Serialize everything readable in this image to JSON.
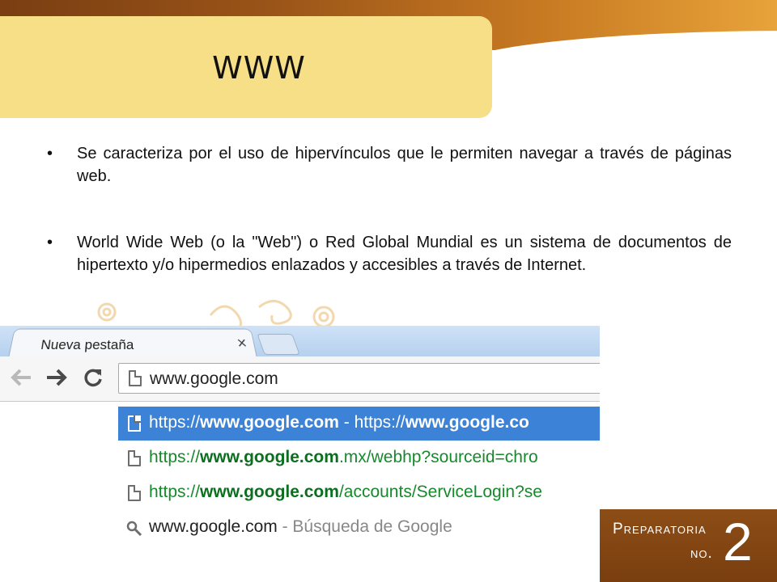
{
  "slide": {
    "title": "WWW",
    "bullets": [
      "Se caracteriza por el uso de hipervínculos que le permiten navegar a través de páginas web.",
      "World Wide Web (o la \"Web\") o Red Global Mundial es un sistema de documentos de hipertexto y/o hipermedios enlazados y accesibles a través de Internet."
    ],
    "bullet_symbol": "•"
  },
  "browser": {
    "tab_label": "Nueva pestaña",
    "tab_close": "×",
    "omnibox_value": "www.google.com",
    "suggestions": [
      {
        "prefix": "https://",
        "bold": "www.google.com",
        "rest": "",
        "separator": " - ",
        "extra_prefix": "https://",
        "extra_bold": "www.google.co",
        "icon": "page-icon"
      },
      {
        "prefix": "https://",
        "bold": "www.google.com",
        "rest": ".mx/webhp?sourceid=chro",
        "icon": "page-icon"
      },
      {
        "prefix": "https://",
        "bold": "www.google.com",
        "rest": "/accounts/ServiceLogin?se",
        "icon": "page-icon"
      },
      {
        "query": "www.google.com",
        "separator": " - ",
        "description": "Búsqueda de Google",
        "icon": "search-icon"
      }
    ]
  },
  "logo": {
    "line1": "Preparatoria",
    "line2": "no.",
    "number": "2"
  },
  "colors": {
    "band_dark": "#7a3e12",
    "band_light": "#e8a33a",
    "title_box": "#f6df86",
    "selected_suggestion": "#3c82d6",
    "url_green": "#168a2b",
    "logo_bg": "#8c4d16"
  }
}
